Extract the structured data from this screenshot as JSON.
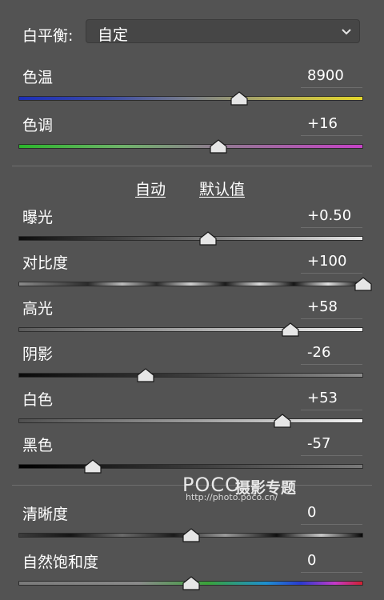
{
  "white_balance": {
    "label": "白平衡:",
    "value": "自定",
    "icon": "chevron-down-icon"
  },
  "auto_label": "自动",
  "default_label": "默认值",
  "sliders": [
    {
      "key": "temperature",
      "label": "色温",
      "value": "8900",
      "level": 0.64
    },
    {
      "key": "tint",
      "label": "色调",
      "value": "+16",
      "level": 0.58
    },
    {
      "key": "exposure",
      "label": "曝光",
      "value": "+0.50",
      "level": 0.55
    },
    {
      "key": "contrast",
      "label": "对比度",
      "value": "+100",
      "level": 1.0
    },
    {
      "key": "highlights",
      "label": "高光",
      "value": "+58",
      "level": 0.79
    },
    {
      "key": "shadows",
      "label": "阴影",
      "value": "-26",
      "level": 0.37
    },
    {
      "key": "whites",
      "label": "白色",
      "value": "+53",
      "level": 0.765
    },
    {
      "key": "blacks",
      "label": "黑色",
      "value": "-57",
      "level": 0.215
    },
    {
      "key": "clarity",
      "label": "清晰度",
      "value": "0",
      "level": 0.5
    },
    {
      "key": "vibrance",
      "label": "自然饱和度",
      "value": "0",
      "level": 0.5
    }
  ],
  "watermark": {
    "logo": "POCO",
    "title": "摄影专题",
    "url": "http://photo.poco.cn/"
  }
}
